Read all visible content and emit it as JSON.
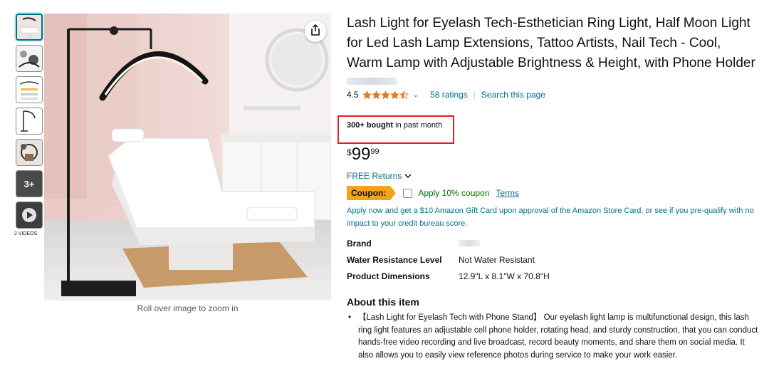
{
  "thumbnails": [
    {
      "name": "thumb-1",
      "selected": true
    },
    {
      "name": "thumb-2",
      "selected": false
    },
    {
      "name": "thumb-3",
      "selected": false
    },
    {
      "name": "thumb-4",
      "selected": false
    },
    {
      "name": "thumb-5",
      "selected": false
    },
    {
      "name": "thumb-6",
      "more_label": "3+"
    },
    {
      "name": "thumb-video"
    }
  ],
  "videos_label": "2 VIDEOS",
  "zoom_hint": "Roll over image to zoom in",
  "product": {
    "title": "Lash Light for Eyelash Tech-Esthetician Ring Light, Half Moon Light for Led Lash Lamp Extensions, Tattoo Artists, Nail Tech - Cool, Warm Lamp with Adjustable Brightness & Height, with Phone Holder",
    "rating": "4.5",
    "rating_value": 4.5,
    "ratings_count": "58 ratings",
    "search_page": "Search this page",
    "bought_bold": "300+ bought",
    "bought_rest": " in past month",
    "price_symbol": "$",
    "price_whole": "99",
    "price_fraction": "99",
    "returns": "FREE Returns",
    "coupon_badge": "Coupon:",
    "coupon_text": "Apply 10% coupon",
    "coupon_terms": "Terms",
    "card_offer": "Apply now and get a $10 Amazon Gift Card upon approval of the Amazon Store Card, or see if you pre-qualify with no impact to your credit bureau score."
  },
  "specs": [
    {
      "label": "Brand",
      "value": ""
    },
    {
      "label": "Water Resistance Level",
      "value": "Not Water Resistant"
    },
    {
      "label": "Product Dimensions",
      "value": "12.9\"L x 8.1\"W x 70.8\"H"
    }
  ],
  "about": {
    "title": "About this item",
    "bullets": [
      "【Lash Light for Eyelash Tech with Phone Stand】 Our eyelash light lamp is multifunctional design, this lash ring light features an adjustable cell phone holder, rotating head, and sturdy construction, that you can conduct hands-free video recording and live broadcast, record beauty moments, and share them on social media. It also allows you to easily view reference photos during service to make your work easier."
    ]
  },
  "colors": {
    "link": "#007185",
    "coupon_badge": "#f7a21b",
    "coupon_text": "#007600",
    "star": "#de7921",
    "highlight_box": "#e02020"
  }
}
